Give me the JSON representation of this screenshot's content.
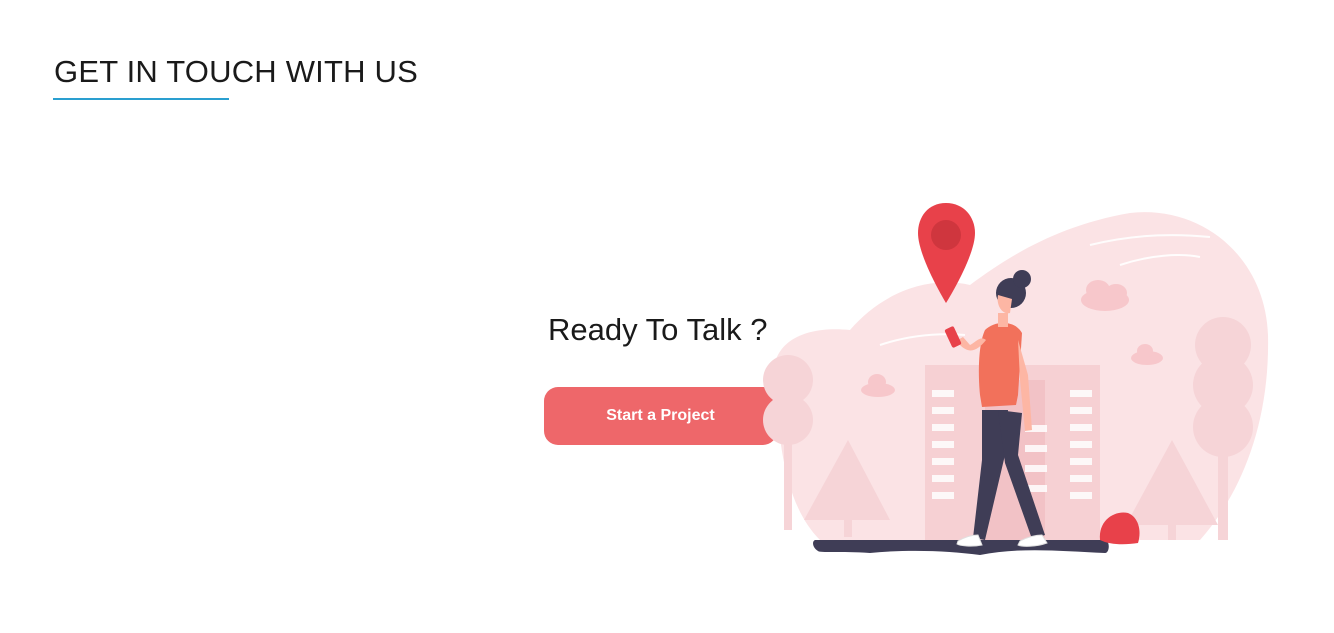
{
  "section": {
    "heading": "GET IN TOUCH WITH US"
  },
  "cta": {
    "title": "Ready To Talk ?",
    "button_label": "Start a Project"
  },
  "colors": {
    "accent_underline": "#2a9fd0",
    "button_bg": "#ee676a",
    "illustration_bg": "#fbe3e5",
    "pin": "#e8414a",
    "figure_dark": "#3f3d56"
  },
  "illustration": {
    "icon": "woman-walking-with-location-pin-illustration"
  }
}
